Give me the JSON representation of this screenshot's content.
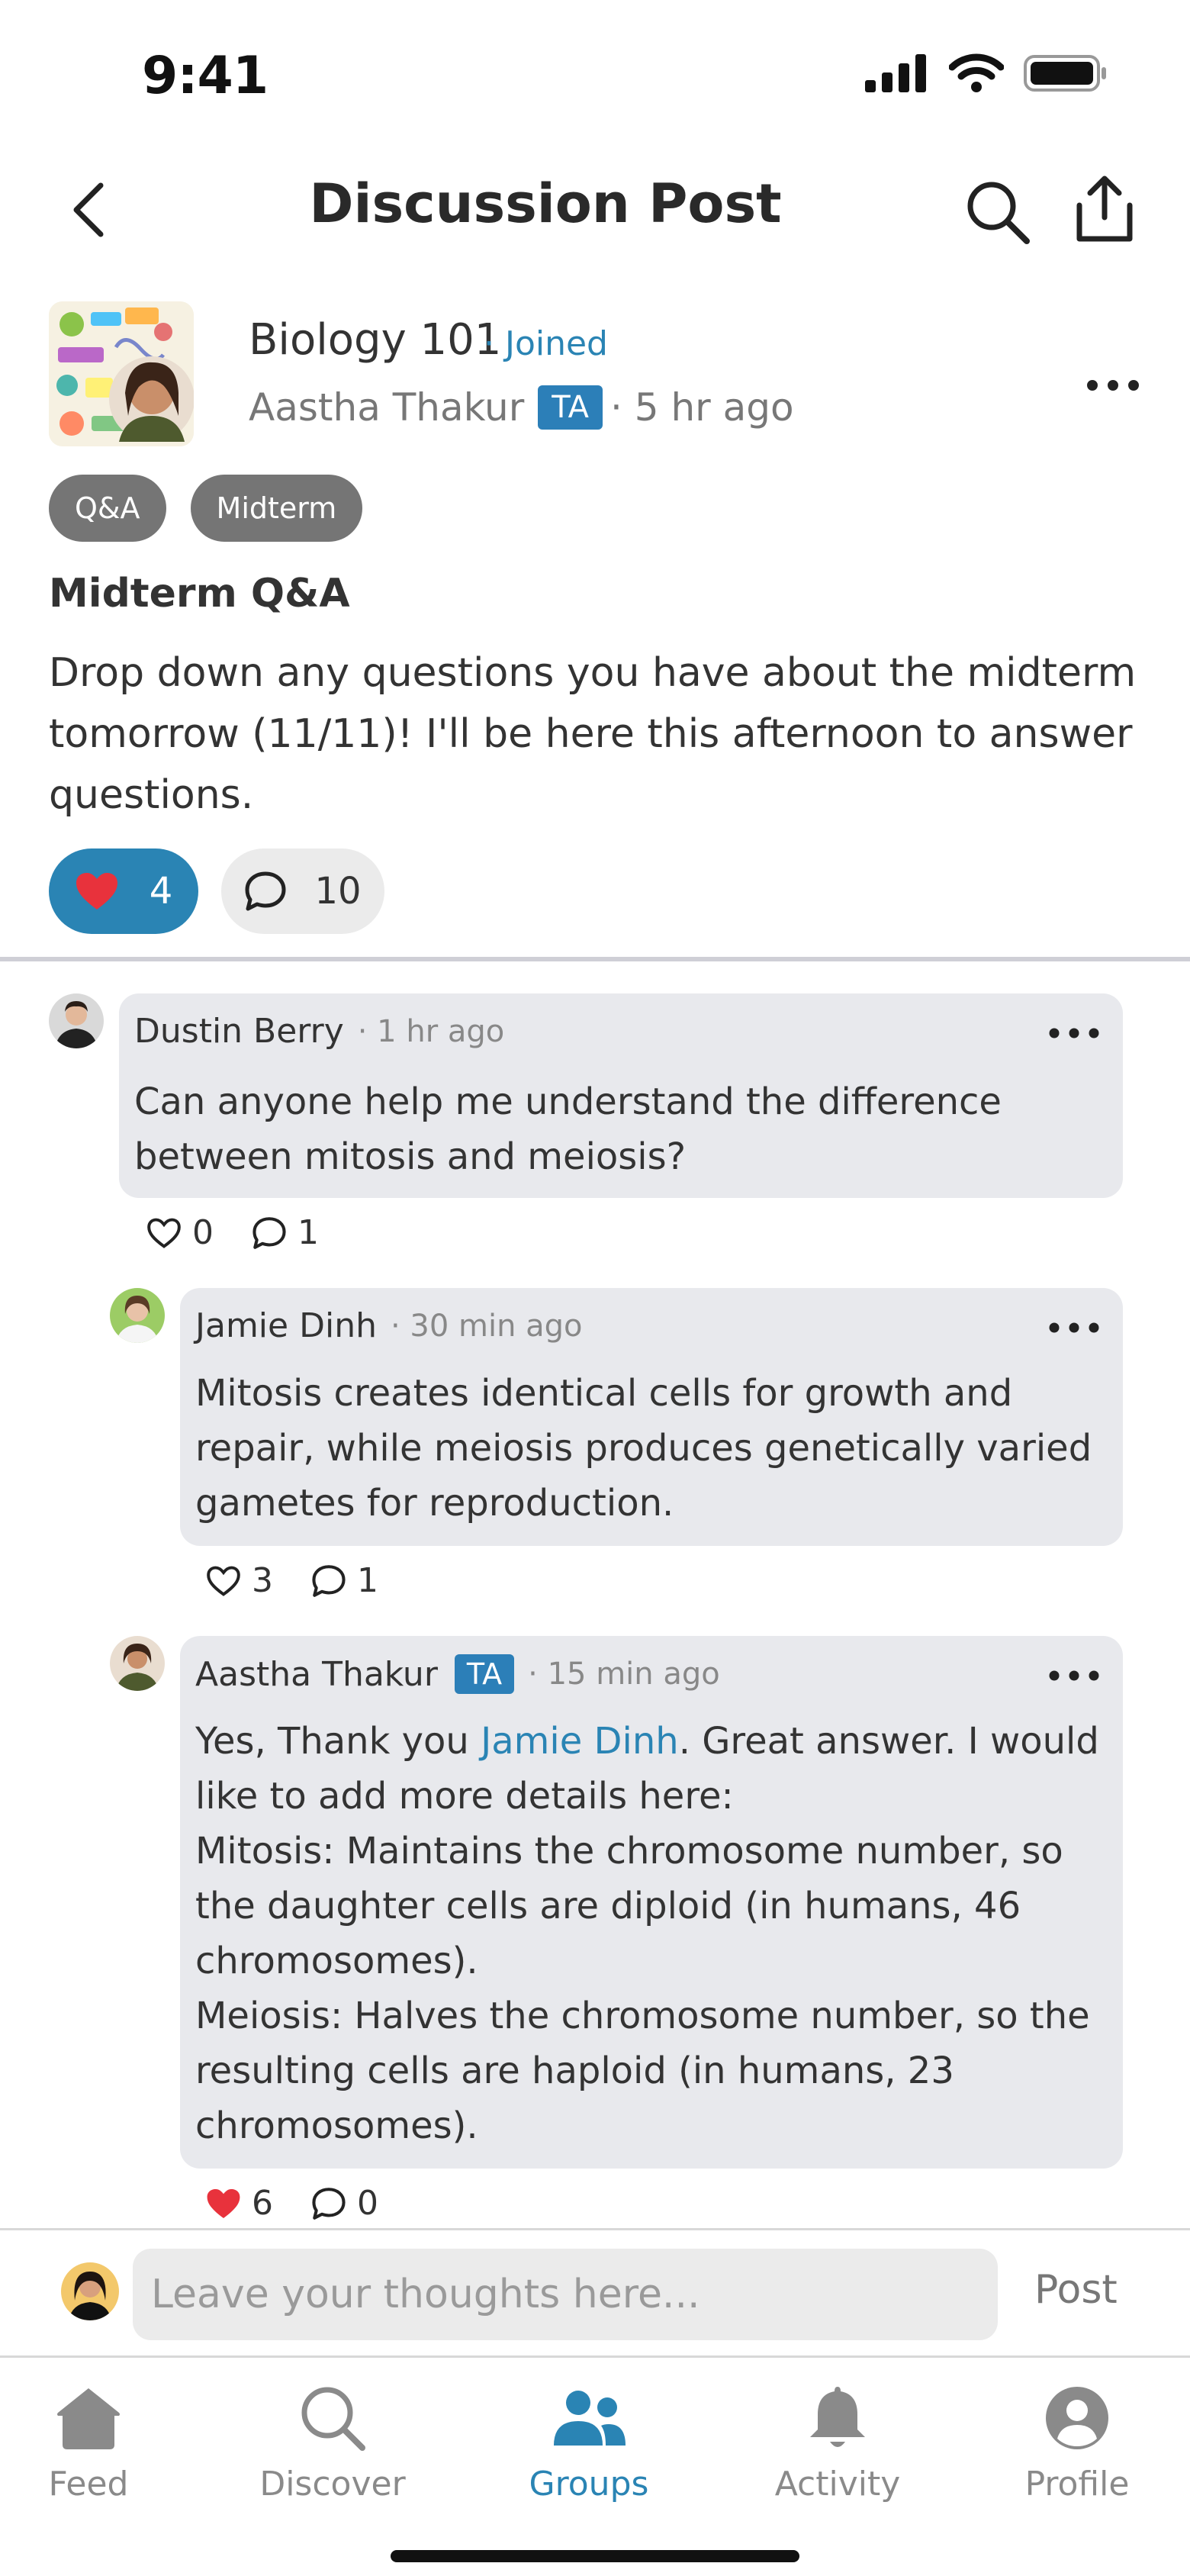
{
  "status_bar": {
    "time": "9:41"
  },
  "nav": {
    "title": "Discussion Post"
  },
  "post": {
    "group_name": "Biology 101",
    "joined_label": "· Joined",
    "author": "Aastha Thakur",
    "author_badge": "TA",
    "time": "· 5 hr ago",
    "tags": [
      "Q&A",
      "Midterm"
    ],
    "title": "Midterm Q&A",
    "body": "Drop down any questions you have about the midterm tomorrow (11/11)! I'll be here this afternoon to answer questions.",
    "likes": "4",
    "comments": "10"
  },
  "comments": [
    {
      "author": "Dustin Berry",
      "time": "· 1 hr ago",
      "text": "Can anyone help me understand the difference between mitosis and meiosis?",
      "likes": "0",
      "replies": "1"
    },
    {
      "author": "Jamie Dinh",
      "time": "· 30 min ago",
      "text": "Mitosis creates identical cells for growth and repair, while meiosis produces genetically varied gametes for reproduction.",
      "likes": "3",
      "replies": "1"
    },
    {
      "author": "Aastha Thakur",
      "badge": "TA",
      "time": "· 15 min ago",
      "text_before": "Yes, Thank you ",
      "mention": "Jamie Dinh",
      "text_after": ". Great answer. I would like to add more details here:",
      "line2": "Mitosis: Maintains the chromosome number, so the daughter cells are diploid (in humans, 46 chromosomes).",
      "line3": "Meiosis: Halves the chromosome number, so the resulting cells are haploid (in humans, 23 chromosomes).",
      "likes": "6",
      "replies": "0"
    }
  ],
  "composer": {
    "placeholder": "Leave your thoughts here...",
    "post_label": "Post"
  },
  "tabs": [
    {
      "label": "Feed",
      "icon": "home-icon"
    },
    {
      "label": "Discover",
      "icon": "search-icon"
    },
    {
      "label": "Groups",
      "icon": "groups-icon",
      "active": true
    },
    {
      "label": "Activity",
      "icon": "bell-icon"
    },
    {
      "label": "Profile",
      "icon": "profile-icon"
    }
  ],
  "colors": {
    "accent": "#2a84b4",
    "bubble": "#e8e9ed",
    "like_red": "#e8323c"
  }
}
